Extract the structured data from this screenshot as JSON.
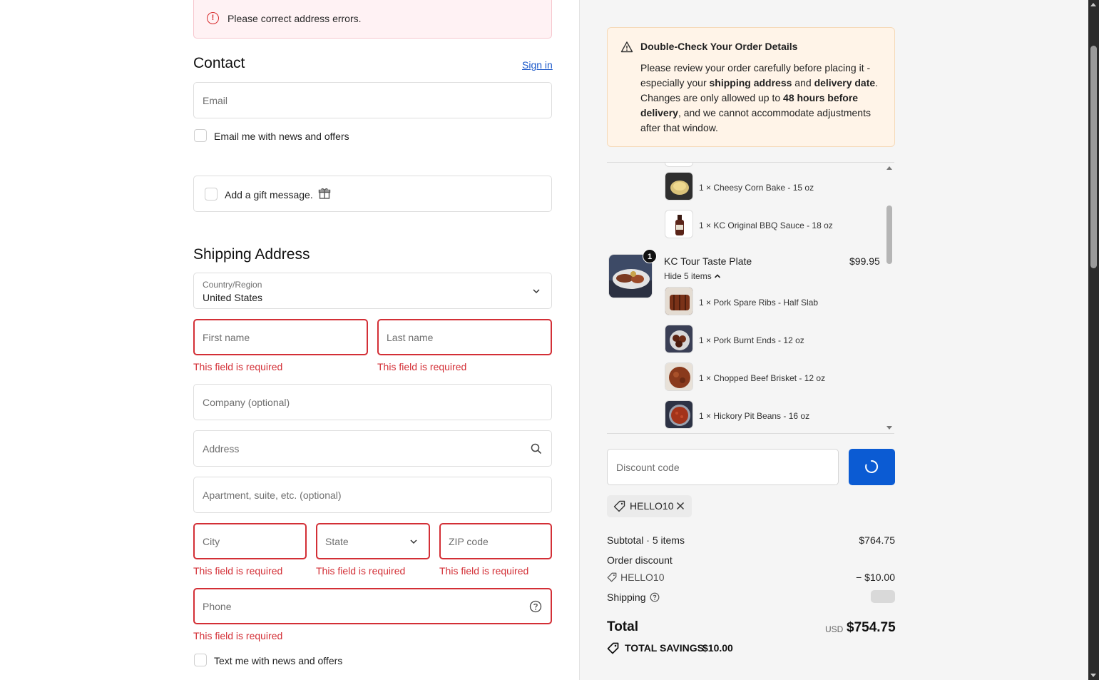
{
  "alert": {
    "message": "Please correct address errors."
  },
  "contact": {
    "title": "Contact",
    "sign_in": "Sign in",
    "email_placeholder": "Email",
    "news_checkbox": "Email me with news and offers",
    "gift_checkbox": "Add a gift message."
  },
  "shipping": {
    "title": "Shipping Address",
    "country_label": "Country/Region",
    "country_value": "United States",
    "first_name": "First name",
    "last_name": "Last name",
    "company": "Company (optional)",
    "address": "Address",
    "apartment": "Apartment, suite, etc. (optional)",
    "city": "City",
    "state": "State",
    "zip": "ZIP code",
    "phone": "Phone",
    "error_text": "This field is required",
    "sms_checkbox": "Text me with news and offers"
  },
  "notice": {
    "title": "Double-Check Your Order Details",
    "line1": "Please review your order carefully before placing it -",
    "line2_a": "especially your ",
    "line2_b": "shipping address",
    "line2_c": " and ",
    "line2_d": "delivery date",
    "line2_e": ".",
    "line3_a": "Changes are only allowed up to ",
    "line3_b": "48 hours before",
    "line4_a": "delivery",
    "line4_b": ", and we cannot accommodate adjustments",
    "line5": "after that window."
  },
  "order": {
    "sub_items_top": [
      {
        "text": "1 × Cheesy Corn Bake - 15 oz",
        "icon": "corn-bake-image"
      },
      {
        "text": "1 × KC Original BBQ Sauce - 18 oz",
        "icon": "bbq-sauce-image"
      }
    ],
    "product": {
      "name": "KC Tour Taste Plate",
      "price": "$99.95",
      "quantity": "1",
      "toggle": "Hide 5 items"
    },
    "sub_items": [
      {
        "text": "1 × Pork Spare Ribs - Half Slab",
        "icon": "ribs-image"
      },
      {
        "text": "1 × Pork Burnt Ends - 12 oz",
        "icon": "burnt-ends-image"
      },
      {
        "text": "1 × Chopped Beef Brisket - 12 oz",
        "icon": "brisket-image"
      },
      {
        "text": "1 × Hickory Pit Beans - 16 oz",
        "icon": "beans-image"
      }
    ]
  },
  "discount": {
    "placeholder": "Discount code",
    "applied_code": "HELLO10"
  },
  "summary": {
    "subtotal_label": "Subtotal · 5 items",
    "subtotal_value": "$764.75",
    "order_discount_label": "Order discount",
    "discount_code": "HELLO10",
    "discount_value": "− $10.00",
    "shipping_label": "Shipping",
    "total_label": "Total",
    "currency": "USD",
    "total_value": "$754.75",
    "savings_label": "TOTAL SAVINGS",
    "savings_value": "$10.00"
  },
  "colors": {
    "error": "#d32f36",
    "accent": "#0b5bd3",
    "notice_bg": "#fff4e8"
  }
}
